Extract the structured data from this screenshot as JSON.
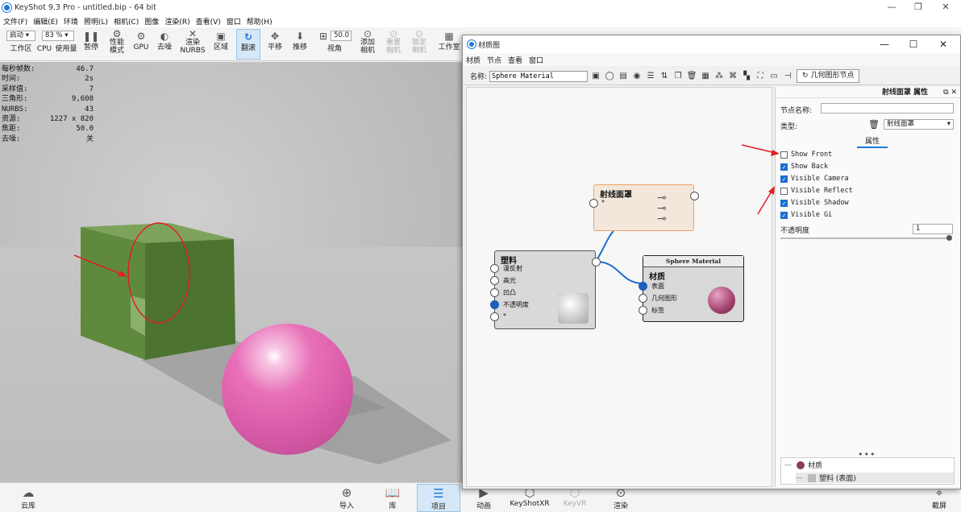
{
  "app": {
    "title": "KeyShot 9.3 Pro  - untitled.bip  - 64 bit"
  },
  "menu": [
    "文件(F)",
    "编辑(E)",
    "环境",
    "照明(L)",
    "相机(C)",
    "图像",
    "渲染(R)",
    "查看(V)",
    "窗口",
    "帮助(H)"
  ],
  "toolbar": {
    "workspace_select": "启动",
    "zoom_select": "83 %",
    "workspace": "工作区",
    "cpu": "CPU",
    "usage": "使用量",
    "pause": "暂停",
    "perf": "性能\n模式",
    "gpu": "GPU",
    "denoise": "去噪",
    "render_nurbs": "渲染\nNURBS",
    "region": "区域",
    "tumble": "翻滚",
    "pan": "平移",
    "dolly": "推移",
    "fov_value": "50.0",
    "fov": "视角",
    "add_camera": "添加\n相机",
    "reset_camera": "重置\n相机",
    "lock_camera": "锁定\n相机",
    "workshop": "工作室"
  },
  "stats": [
    [
      "每秒帧数:",
      "46.7"
    ],
    [
      "时间:",
      "2s"
    ],
    [
      "采样值:",
      "7"
    ],
    [
      "三角形:",
      "9,608"
    ],
    [
      "NURBS:",
      "43"
    ],
    [
      "资源:",
      "1227 x 820"
    ],
    [
      "焦距:",
      "50.0"
    ],
    [
      "去噪:",
      "关"
    ]
  ],
  "bottombar": {
    "cloud": "云库",
    "import": "导入",
    "library": "库",
    "project": "项目",
    "animation": "动画",
    "keyshotxr": "KeyShotXR",
    "keyvr": "KeyVR",
    "render": "渲染",
    "screenshot": "截屏"
  },
  "material_window": {
    "title": "材质图",
    "menu": [
      "材质",
      "节点",
      "查看",
      "窗口"
    ],
    "name_label": "名称:",
    "name_value": "Sphere Material",
    "geometry_node_button": "几何图形节点",
    "nodes": {
      "wireframe": {
        "title": "射线面罩",
        "port_star": "*"
      },
      "plastic": {
        "title": "塑料",
        "ports": [
          "漫反射",
          "高光",
          "凹凸",
          "不透明度",
          "*"
        ]
      },
      "material": {
        "header": "Sphere Material",
        "title": "材质",
        "ports": [
          "表面",
          "几何图形",
          "标签"
        ]
      }
    },
    "properties": {
      "header": "射线面罩  属性",
      "node_name_label": "节点名称:",
      "node_name_value": "",
      "type_label": "类型:",
      "type_value": "射线面罩",
      "tab": "属性",
      "checkboxes": [
        {
          "label": "Show Front",
          "checked": false
        },
        {
          "label": "Show Back",
          "checked": true
        },
        {
          "label": "Visible Camera",
          "checked": true
        },
        {
          "label": "Visible Reflect",
          "checked": false
        },
        {
          "label": "Visible Shadow",
          "checked": true
        },
        {
          "label": "Visible Gi",
          "checked": true
        }
      ],
      "opacity_label": "不透明度",
      "opacity_value": "1",
      "tree": {
        "root": "材质",
        "child": "塑料 (表面)"
      }
    }
  },
  "colors": {
    "accent": "#1e78d7",
    "annotation": "#e02020"
  }
}
